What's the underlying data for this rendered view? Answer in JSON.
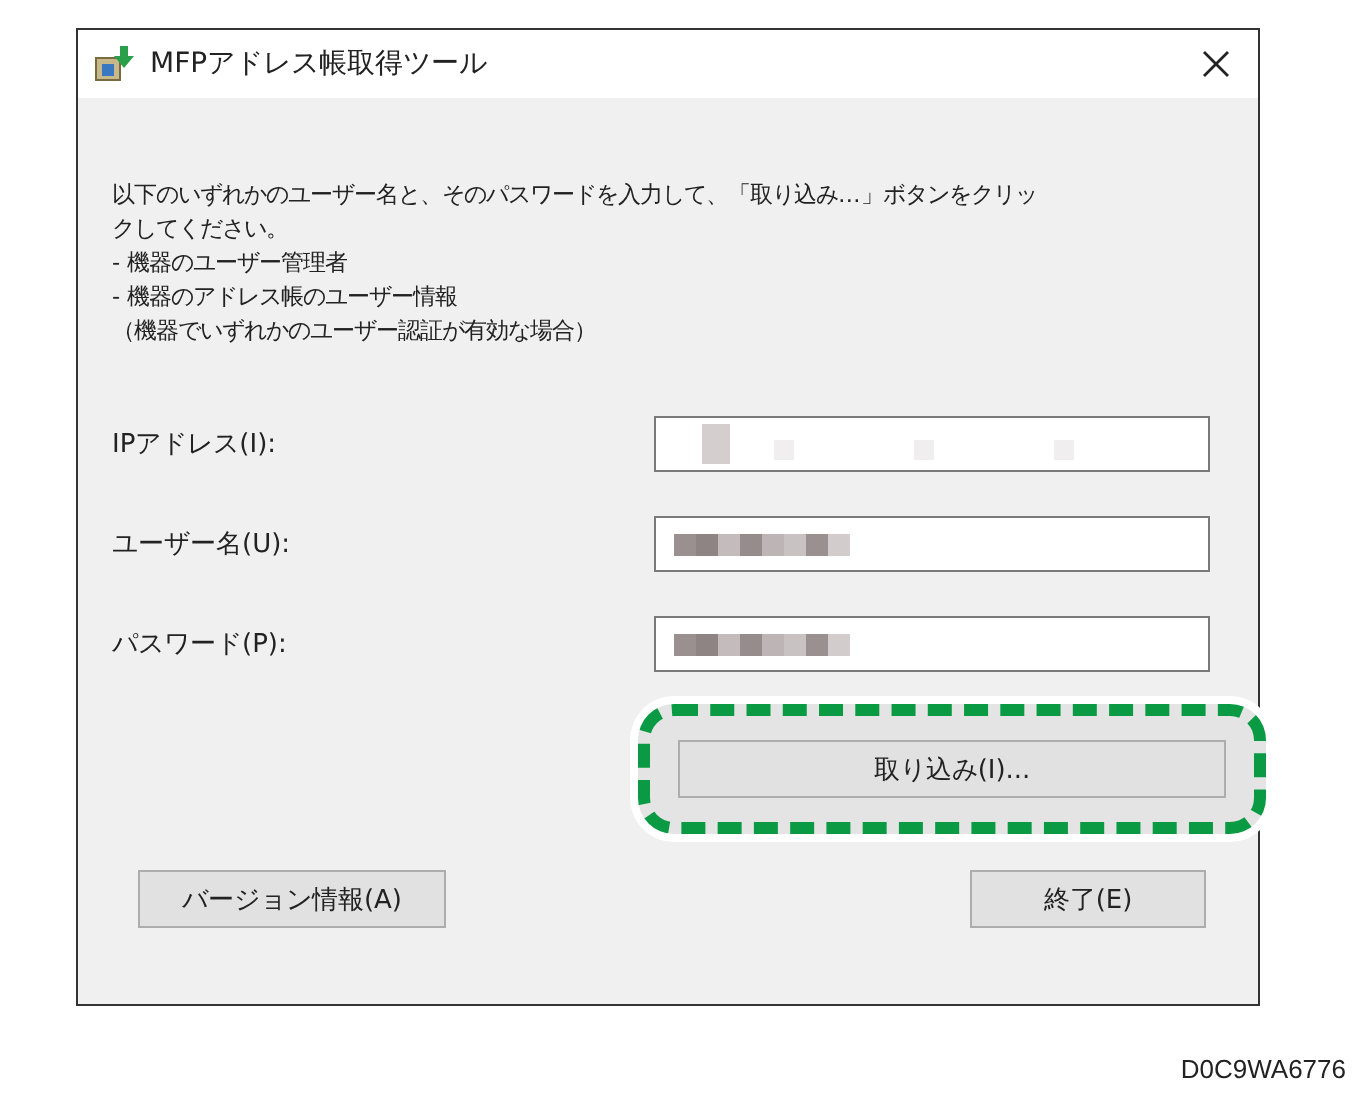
{
  "window": {
    "title": "MFPアドレス帳取得ツール"
  },
  "instructions": [
    "以下のいずれかのユーザー名と、そのパスワードを入力して、「取り込み…」ボタンをクリックしてください。",
    "- 機器のユーザー管理者",
    "- 機器のアドレス帳のユーザー情報",
    "（機器でいずれかのユーザー認証が有効な場合）"
  ],
  "fields": [
    {
      "label": "IPアドレス(I):",
      "kind": "sparse"
    },
    {
      "label": "ユーザー名(U):",
      "kind": "dense"
    },
    {
      "label": "パスワード(P):",
      "kind": "dense"
    }
  ],
  "import_button": {
    "label": "取り込み(I)...",
    "highlighted": true
  },
  "buttons": [
    {
      "label": "バージョン情報(A)"
    },
    {
      "label": "終了(E)"
    }
  ],
  "figure_id": "D0C9WA6776"
}
